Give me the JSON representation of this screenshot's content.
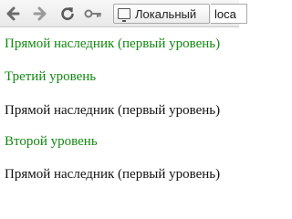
{
  "toolbar": {
    "identity_label": "Локальный",
    "url_text": "loca"
  },
  "colors": {
    "green_text": "#118811",
    "black_text": "#111111"
  },
  "content": {
    "lines": [
      {
        "text": "Прямой наследник (первый уровень)",
        "color": "green"
      },
      {
        "text": "Третий уровень",
        "color": "green"
      },
      {
        "text": "Прямой наследник (первый уровень)",
        "color": "black"
      },
      {
        "text": "Второй уровень",
        "color": "green"
      },
      {
        "text": "Прямой наследник (первый уровень)",
        "color": "black"
      }
    ]
  },
  "icons": {
    "back": "arrow-left-icon",
    "forward": "arrow-right-icon",
    "reload": "reload-icon",
    "key": "key-icon",
    "identity": "page-icon"
  }
}
